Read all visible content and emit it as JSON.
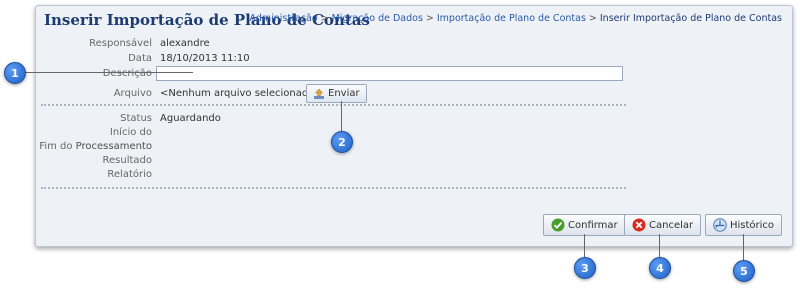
{
  "window": {
    "title": "Inserir Importação de Plano de Contas",
    "breadcrumb": [
      "Administração",
      "Migração de Dados",
      "Importação de Plano de Contas",
      "Inserir Importação de Plano de Contas"
    ],
    "breadcrumb_sep": ">"
  },
  "form": {
    "responsavel_label": "Responsável",
    "responsavel_value": "alexandre",
    "data_label": "Data",
    "data_value": "18/10/2013 11:10",
    "descricao_label": "Descrição",
    "descricao_value": "",
    "arquivo_label": "Arquivo",
    "arquivo_value": "<Nenhum arquivo selecionado>",
    "enviar_label": "Enviar",
    "status_label": "Status",
    "status_value": "Aguardando",
    "inicio_label": "Início do Processamento",
    "fim_label": "Fim do Processamento",
    "resultado_label": "Resultado",
    "relatorio_label": "Relatório"
  },
  "buttons": {
    "confirmar": "Confirmar",
    "cancelar": "Cancelar",
    "historico": "Histórico"
  },
  "callouts": [
    "1",
    "2",
    "3",
    "4",
    "5"
  ],
  "colors": {
    "title": "#1d3b73",
    "callout": "#2f74d8",
    "confirm": "#4a9e2a",
    "cancel": "#d62b1f"
  }
}
